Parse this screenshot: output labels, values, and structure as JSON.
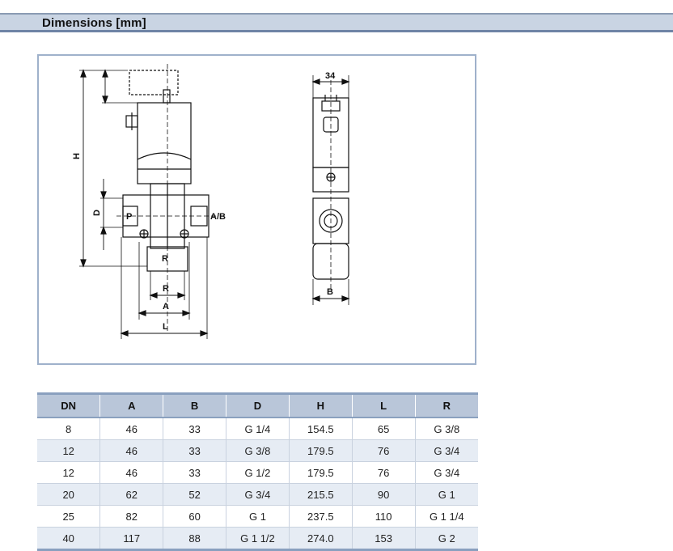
{
  "header": {
    "title": "Dimensions [mm]"
  },
  "drawing": {
    "labels": {
      "H": "H",
      "D": "D",
      "P": "P",
      "AB": "A/B",
      "R_inner": "R",
      "R": "R",
      "A": "A",
      "L": "L",
      "B": "B",
      "W34": "34"
    }
  },
  "table": {
    "columns": [
      "DN",
      "A",
      "B",
      "D",
      "H",
      "L",
      "R"
    ],
    "rows": [
      [
        "8",
        "46",
        "33",
        "G 1/4",
        "154.5",
        "65",
        "G 3/8"
      ],
      [
        "12",
        "46",
        "33",
        "G 3/8",
        "179.5",
        "76",
        "G 3/4"
      ],
      [
        "12",
        "46",
        "33",
        "G 1/2",
        "179.5",
        "76",
        "G 3/4"
      ],
      [
        "20",
        "62",
        "52",
        "G 3/4",
        "215.5",
        "90",
        "G 1"
      ],
      [
        "25",
        "82",
        "60",
        "G 1",
        "237.5",
        "110",
        "G 1 1/4"
      ],
      [
        "40",
        "117",
        "88",
        "G 1 1/2",
        "274.0",
        "153",
        "G 2"
      ]
    ]
  }
}
